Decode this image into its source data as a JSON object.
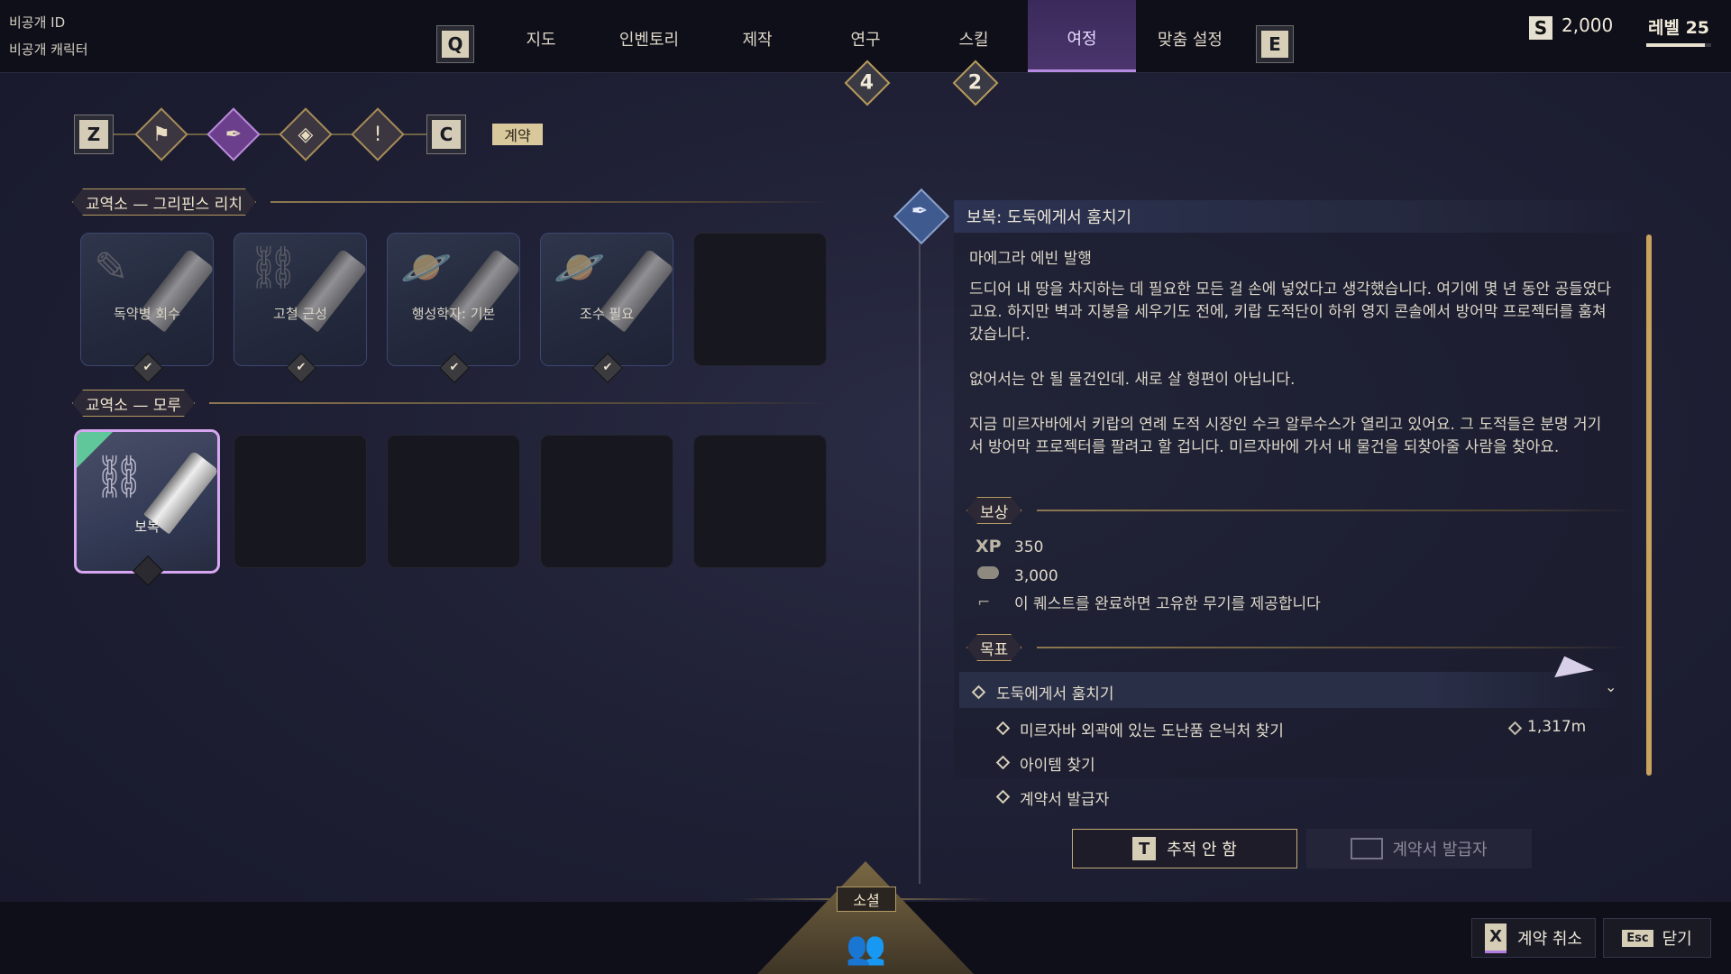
{
  "account": {
    "id_label": "비공개 ID",
    "character_label": "비공개 캐릭터"
  },
  "nav": {
    "q_key": "Q",
    "e_key": "E",
    "tabs": [
      {
        "label": "지도"
      },
      {
        "label": "인벤토리"
      },
      {
        "label": "제작"
      },
      {
        "label": "연구",
        "badge": "4"
      },
      {
        "label": "스킬",
        "badge": "2"
      },
      {
        "label": "여정",
        "active": true
      },
      {
        "label": "맞춤 설정"
      }
    ],
    "currency_icon": "S",
    "currency": "2,000",
    "level_label": "레벨 25",
    "level_progress": 0.9
  },
  "subnav": {
    "z_key": "Z",
    "c_key": "C",
    "active_label": "계약"
  },
  "sections": [
    {
      "title": "교역소 — 그리핀스 리치",
      "cards": [
        {
          "label": "독약병 회수",
          "icon": "document-icon",
          "completed": true
        },
        {
          "label": "고철 근성",
          "icon": "chain-icon",
          "completed": true
        },
        {
          "label": "행성학자: 기본",
          "icon": "planet-icon",
          "completed": true
        },
        {
          "label": "조수 필요",
          "icon": "planet-icon",
          "completed": true
        },
        {
          "label": ""
        }
      ]
    },
    {
      "title": "교역소 — 모루",
      "cards": [
        {
          "label": "보복",
          "icon": "chain-icon",
          "selected": true
        },
        {
          "label": ""
        },
        {
          "label": ""
        },
        {
          "label": ""
        },
        {
          "label": ""
        }
      ]
    }
  ],
  "detail": {
    "title": "보복: 도둑에게서 훔치기",
    "issuer": "마에그라 에빈 발행",
    "paragraphs": [
      "드디어 내 땅을 차지하는 데 필요한 모든 걸 손에 넣었다고 생각했습니다. 여기에 몇 년 동안 공들였다고요. 하지만 벽과 지붕을 세우기도 전에, 키랍 도적단이 하위 영지 콘솔에서 방어막 프로젝터를 훔쳐 갔습니다.",
      "없어서는 안 될 물건인데. 새로 살 형편이 아닙니다.",
      "지금 미르자바에서 키랍의 연례 도적 시장인 수크 알루수스가 열리고 있어요. 그 도적들은 분명 거기서 방어막 프로젝터를 팔려고 할 겁니다. 미르자바에 가서 내 물건을 되찾아줄 사람을 찾아요."
    ],
    "rewards_title": "보상",
    "rewards": {
      "xp_label": "XP",
      "xp": "350",
      "currency": "3,000",
      "weapon_note": "이 퀘스트를 완료하면 고유한 무기를 제공합니다"
    },
    "objectives_title": "목표",
    "objectives": {
      "main": "도둑에게서 훔치기",
      "subs": [
        {
          "label": "미르자바 외곽에 있는 도난품 은닉처 찾기",
          "distance": "1,317m"
        },
        {
          "label": "아이템 찾기"
        },
        {
          "label": "계약서 발급자"
        }
      ]
    },
    "track_key": "T",
    "track_label": "추적 안 함",
    "issuer_button_label": "계약서 발급자"
  },
  "bottom": {
    "social_label": "소셜",
    "cancel_key": "X",
    "cancel_label": "계약 취소",
    "close_key": "Esc",
    "close_label": "닫기"
  }
}
